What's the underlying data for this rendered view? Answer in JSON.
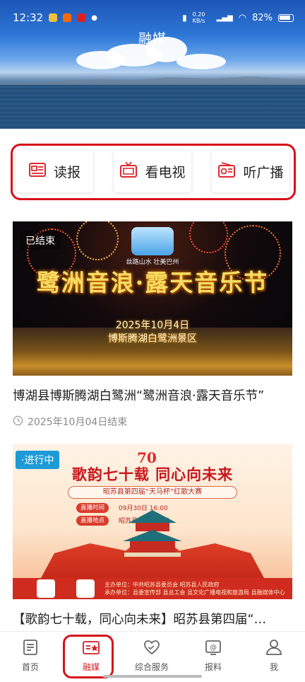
{
  "status_bar": {
    "time": "12:32",
    "network_speed": "0.20 KB/s",
    "battery": "82%"
  },
  "header": {
    "title": "融媒"
  },
  "quick_access": [
    {
      "label": "读报",
      "icon": "newspaper-icon"
    },
    {
      "label": "看电视",
      "icon": "tv-icon"
    },
    {
      "label": "听广播",
      "icon": "radio-icon"
    }
  ],
  "cards": [
    {
      "status": "已结束",
      "image_title": "鹭洲音浪·露天音乐节",
      "image_subtitle_date": "2025年10月4日",
      "image_subtitle_place": "博斯腾湖白鹭洲景区",
      "image_logo_text": "丝路山水 壮美巴州",
      "title": "博湖县博斯腾湖白鹭洲“鹭洲音浪·露天音乐节”",
      "meta": "2025年10月04日结束"
    },
    {
      "status": "·进行中",
      "image_anniversary": "70",
      "image_title": "歌韵七十载 同心向未来",
      "image_ribbon": "昭苏县第四届“天马杯”红歌大赛",
      "image_time_label": "直播时间",
      "image_time_value": "09月30日 16:00",
      "image_place_label": "直播地点",
      "image_place_value": "昭苏县·三馆一中心",
      "image_footer": "主办单位：中共昭苏县委员会 昭苏县人民政府\n承办单位：县委宣传部 县总工会 县文化广播电视和旅游局 县融媒体中心",
      "title": "【歌韵七十载，同心向未来】昭苏县第四届“…"
    }
  ],
  "bottom_nav": [
    {
      "label": "首页",
      "icon": "home-doc-icon",
      "active": false
    },
    {
      "label": "融媒",
      "icon": "media-card-icon",
      "active": true
    },
    {
      "label": "综合服务",
      "icon": "heart-hand-icon",
      "active": false
    },
    {
      "label": "报料",
      "icon": "at-report-icon",
      "active": false
    },
    {
      "label": "我",
      "icon": "user-icon",
      "active": false
    }
  ],
  "colors": {
    "accent_red": "#d41d26",
    "highlight_outline": "#d8101a",
    "live_badge": "#1e9bd7"
  }
}
